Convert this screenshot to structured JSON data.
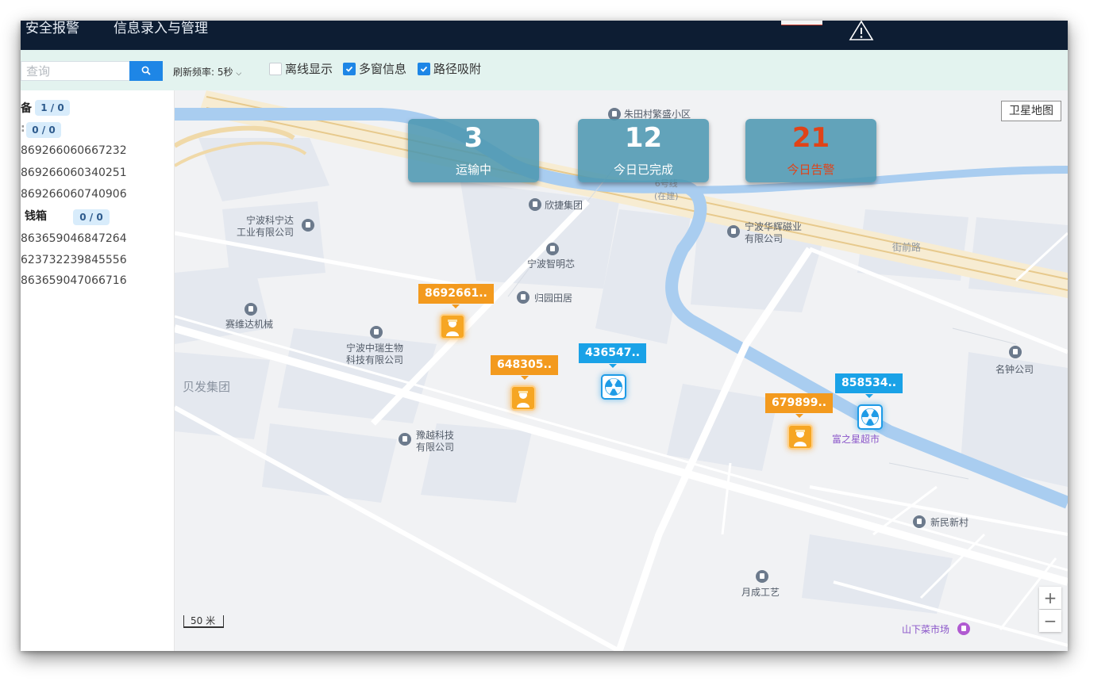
{
  "header": {
    "nav": [
      "安全报警",
      "信息录入与管理"
    ],
    "alert_icon": "warning-triangle-icon"
  },
  "toolbar": {
    "search_placeholder": "查询",
    "search_icon": "search-icon",
    "refresh_label": "刷新频率:",
    "refresh_value": "5秒",
    "checkboxes": [
      {
        "label": "离线显示",
        "checked": false
      },
      {
        "label": "多窗信息",
        "checked": true
      },
      {
        "label": "路径吸附",
        "checked": true
      }
    ]
  },
  "sidebar": {
    "groups": [
      {
        "title": "备",
        "count": "1 / 0",
        "devices": [
          "869266060667232",
          "869266060340251",
          "869266060740906"
        ]
      },
      {
        "title": "",
        "count": "0 / 0",
        "devices": []
      },
      {
        "title": "钱箱",
        "count": "0 / 0",
        "devices": [
          "863659046847264",
          "623732239845556",
          "863659047066716"
        ]
      }
    ]
  },
  "stats": [
    {
      "value": "3",
      "label": "运输中"
    },
    {
      "value": "12",
      "label": "今日已完成"
    },
    {
      "value": "21",
      "label": "今日告警"
    }
  ],
  "map": {
    "satellite_button": "卫星地图",
    "scale_label": "50 米",
    "zoom_in": "+",
    "zoom_out": "−",
    "markers": [
      {
        "label": "8692661..",
        "type": "worker"
      },
      {
        "label": "648305..",
        "type": "worker"
      },
      {
        "label": "436547..",
        "type": "radiation"
      },
      {
        "label": "858534..",
        "type": "radiation"
      },
      {
        "label": "679899..",
        "type": "worker"
      }
    ],
    "pois": {
      "zhutian": "朱田村繁盛小区",
      "xinjie": "欣捷集团",
      "kedi": "宁波科宁达\n工业有限公司",
      "huahui": "宁波华辉磁业\n有限公司",
      "zhiming": "宁波智明芯",
      "guiyuan": "归园田居",
      "saiwei": "赛维达机械",
      "zhongrui": "宁波中瑞生物\n科技有限公司",
      "beifa": "贝发集团",
      "yuyue": "豫越科技\n有限公司",
      "fuzhixing": "富之星超市",
      "mingzhong": "名钟公司",
      "xinmin": "新民新村",
      "yuecheng": "月成工艺",
      "shanxiacai": "山下菜市场",
      "jieqian": "街前路",
      "line6": "6号线\n(在建)"
    }
  }
}
